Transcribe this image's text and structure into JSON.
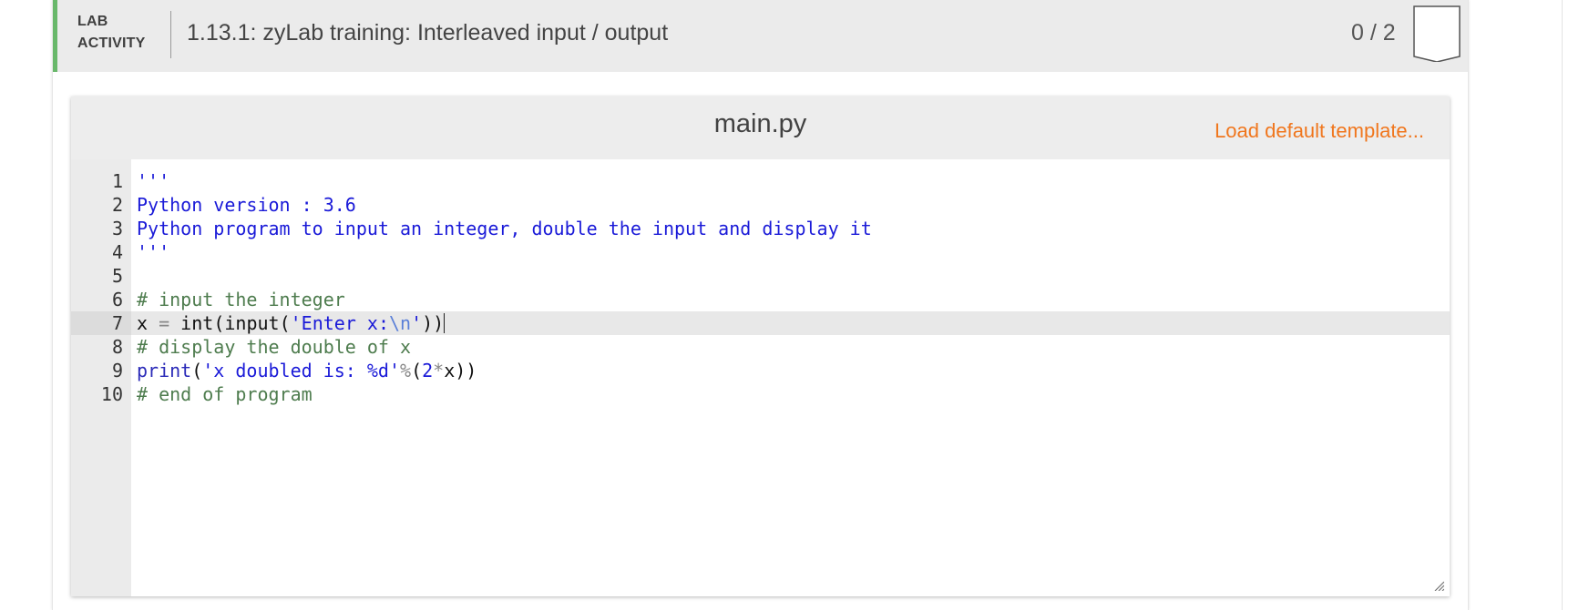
{
  "activity": {
    "type_line1": "LAB",
    "type_line2": "ACTIVITY",
    "title": "1.13.1: zyLab training: Interleaved input / output",
    "score": "0 / 2",
    "accent_color": "#69b86b"
  },
  "editor": {
    "filename": "main.py",
    "load_template_label": "Load default template...",
    "link_color": "#f0761d",
    "active_line": 7,
    "lines": [
      {
        "n": "1",
        "tokens": [
          {
            "t": "'''",
            "c": "string"
          }
        ]
      },
      {
        "n": "2",
        "tokens": [
          {
            "t": "Python version : 3.6",
            "c": "string"
          }
        ]
      },
      {
        "n": "3",
        "tokens": [
          {
            "t": "Python program to input an integer, double the input and display it",
            "c": "string"
          }
        ]
      },
      {
        "n": "4",
        "tokens": [
          {
            "t": "'''",
            "c": "string"
          }
        ]
      },
      {
        "n": "5",
        "tokens": []
      },
      {
        "n": "6",
        "tokens": [
          {
            "t": "# input the integer",
            "c": "comment"
          }
        ]
      },
      {
        "n": "7",
        "tokens": [
          {
            "t": "x ",
            "c": "plain"
          },
          {
            "t": "=",
            "c": "op"
          },
          {
            "t": " int",
            "c": "plain"
          },
          {
            "t": "(",
            "c": "plain"
          },
          {
            "t": "input",
            "c": "plain"
          },
          {
            "t": "(",
            "c": "plain"
          },
          {
            "t": "'Enter x:",
            "c": "string"
          },
          {
            "t": "\\n",
            "c": "escape"
          },
          {
            "t": "'",
            "c": "string"
          },
          {
            "t": "))",
            "c": "plain"
          }
        ]
      },
      {
        "n": "8",
        "tokens": [
          {
            "t": "# display the double of x",
            "c": "comment"
          }
        ]
      },
      {
        "n": "9",
        "tokens": [
          {
            "t": "print",
            "c": "kw"
          },
          {
            "t": "(",
            "c": "plain"
          },
          {
            "t": "'x doubled is: %d'",
            "c": "string"
          },
          {
            "t": "%",
            "c": "op"
          },
          {
            "t": "(",
            "c": "plain"
          },
          {
            "t": "2",
            "c": "num"
          },
          {
            "t": "*",
            "c": "op"
          },
          {
            "t": "x))",
            "c": "plain"
          }
        ]
      },
      {
        "n": "10",
        "tokens": [
          {
            "t": "# end of program",
            "c": "comment"
          }
        ]
      }
    ]
  },
  "icons": {
    "completion_badge": "bookmark-badge-icon",
    "resize_handle": "resize-handle-icon"
  }
}
